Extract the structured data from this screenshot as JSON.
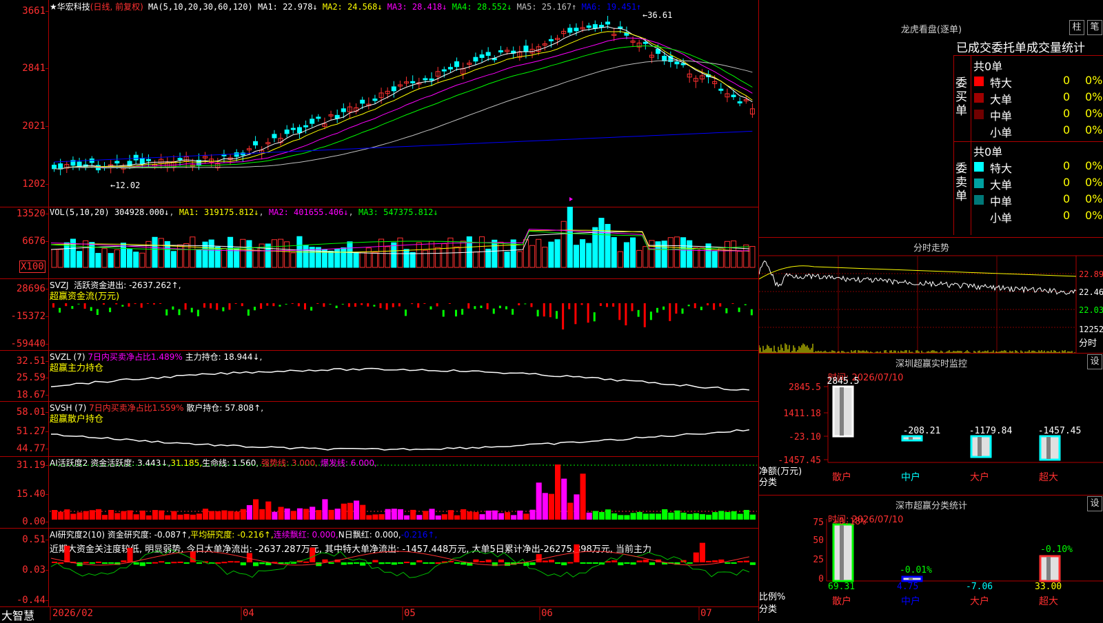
{
  "stock": {
    "name_label": "★华宏科技",
    "period_label": "(日线, 前复权)"
  },
  "main": {
    "ma_header": "MA(5,10,20,30,60,120)",
    "ma_values": [
      {
        "label": "MA1:",
        "value": "22.978↓",
        "color": "#ffffff"
      },
      {
        "label": "MA2:",
        "value": "24.568↓",
        "color": "#ffff00"
      },
      {
        "label": "MA3:",
        "value": "28.418↓",
        "color": "#ff00ff"
      },
      {
        "label": "MA4:",
        "value": "28.552↓",
        "color": "#00ff00"
      },
      {
        "label": "MA5:",
        "value": "25.167↑",
        "color": "#c0c0c0"
      },
      {
        "label": "MA6:",
        "value": "19.451↑",
        "color": "#0000ff"
      }
    ],
    "y_ticks": [
      "3661",
      "2841",
      "2021",
      "1202"
    ],
    "high_label": "←36.61",
    "low_label": "←12.02"
  },
  "vol": {
    "header": "VOL(5,10,20)",
    "value": "304928.000↓",
    "ma1": "MA1: 319175.812↓",
    "ma2": "MA2: 401655.406↓",
    "ma3": "MA3: 547375.812↓",
    "y_ticks": [
      "13520",
      "6676"
    ],
    "unit": "X100"
  },
  "svzj": {
    "title": "SVZJ",
    "line1": "活跃资金进出: -2637.262↑,",
    "line2": "超赢资金流(万元)",
    "y_ticks": [
      "28696",
      "-15372",
      "-59440"
    ]
  },
  "svzl": {
    "title": "SVZL (7)",
    "ratio": "7日内买卖净占比1.489%",
    "hold": "主力持仓: 18.944↓,",
    "line2": "超赢主力持仓",
    "y_ticks": [
      "32.51",
      "25.59",
      "18.67"
    ]
  },
  "svsh": {
    "title": "SVSH (7)",
    "ratio": "7日内买卖净占比1.559%",
    "hold": "散户持仓: 57.808↑,",
    "line2": "超赢散户持仓",
    "y_ticks": [
      "58.01",
      "51.27",
      "44.77"
    ]
  },
  "ai1": {
    "title": "AI活跃度2",
    "v1": "资金活跃度: 3.443↓,",
    "v2": "31.185,",
    "v3": "生命线: 1.560,",
    "v4": "强势线: 3.000,",
    "v5": "爆发线: 6.000,",
    "y_ticks": [
      "31.19",
      "15.40",
      "0.00"
    ]
  },
  "ai2": {
    "title": "AI研究度2(10)",
    "v1": "资金研究度: -0.087↑,",
    "v2": "平均研究度: -0.216↑,",
    "v3": "连续飘红: 0.000,",
    "v4": "N日飘红: 0.000,",
    "v5": "-0.216↑,",
    "note": "近期大资金关注度较低, 明显弱势, 今日大单净流出: -2637.287万元, 其中特大单净流出: -1457.448万元, 大单5日累计净出-26275.898万元, 当前主力",
    "y_ticks": [
      "0.51",
      "0.03",
      "-0.44"
    ]
  },
  "xaxis": {
    "app": "大智慧",
    "labels": [
      "2026/02",
      "04",
      "05",
      "06",
      "07"
    ]
  },
  "right": {
    "lhb_title": "龙虎看盘(逐单)",
    "btn_bar": "柱",
    "btn_pen": "笔",
    "tabs": "已成交委托单成交量统计",
    "buy": {
      "side": "委买单",
      "count": "共0单",
      "rows": [
        {
          "label": "特大",
          "v": "0",
          "p": "0%",
          "color": "#ff0000"
        },
        {
          "label": "大单",
          "v": "0",
          "p": "0%",
          "color": "#a00000"
        },
        {
          "label": "中单",
          "v": "0",
          "p": "0%",
          "color": "#700000"
        },
        {
          "label": "小单",
          "v": "0",
          "p": "0%",
          "color": ""
        }
      ]
    },
    "sell": {
      "side": "委卖单",
      "count": "共0单",
      "rows": [
        {
          "label": "特大",
          "v": "0",
          "p": "0%",
          "color": "#00ffff"
        },
        {
          "label": "大单",
          "v": "0",
          "p": "0%",
          "color": "#00a0a0"
        },
        {
          "label": "中单",
          "v": "0",
          "p": "0%",
          "color": "#007878"
        },
        {
          "label": "小单",
          "v": "0",
          "p": "0%",
          "color": ""
        }
      ]
    },
    "ts_title": "分时走势",
    "ts_ticks": [
      "22.89",
      "22.46",
      "22.03",
      "12252"
    ],
    "ts_unit": "分时",
    "sz_title": "深圳超赢实时监控",
    "sz_time": "时间: 2026/07/10",
    "sz_ticks": [
      "2845.5",
      "1411.18",
      "-23.10",
      "-1457.45"
    ],
    "sz_vals": [
      "2845.5",
      "-208.21",
      "-1179.84",
      "-1457.45"
    ],
    "sz_unit": "净额(万元)",
    "cat_label": "分类",
    "cats": [
      "散户",
      "中户",
      "大户",
      "超大"
    ],
    "set": "设",
    "ss_title": "深市超赢分类统计",
    "ss_time": "时间: 2026/07/10",
    "ss_ticks": [
      "75",
      "50",
      "25",
      "0"
    ],
    "ss_top": [
      "+0.18%",
      "-0.01%",
      "",
      "-0.10%"
    ],
    "ss_vals": [
      "69.31",
      "4.75",
      "-7.06",
      "33.00"
    ],
    "ss_unit": "比例%"
  }
}
